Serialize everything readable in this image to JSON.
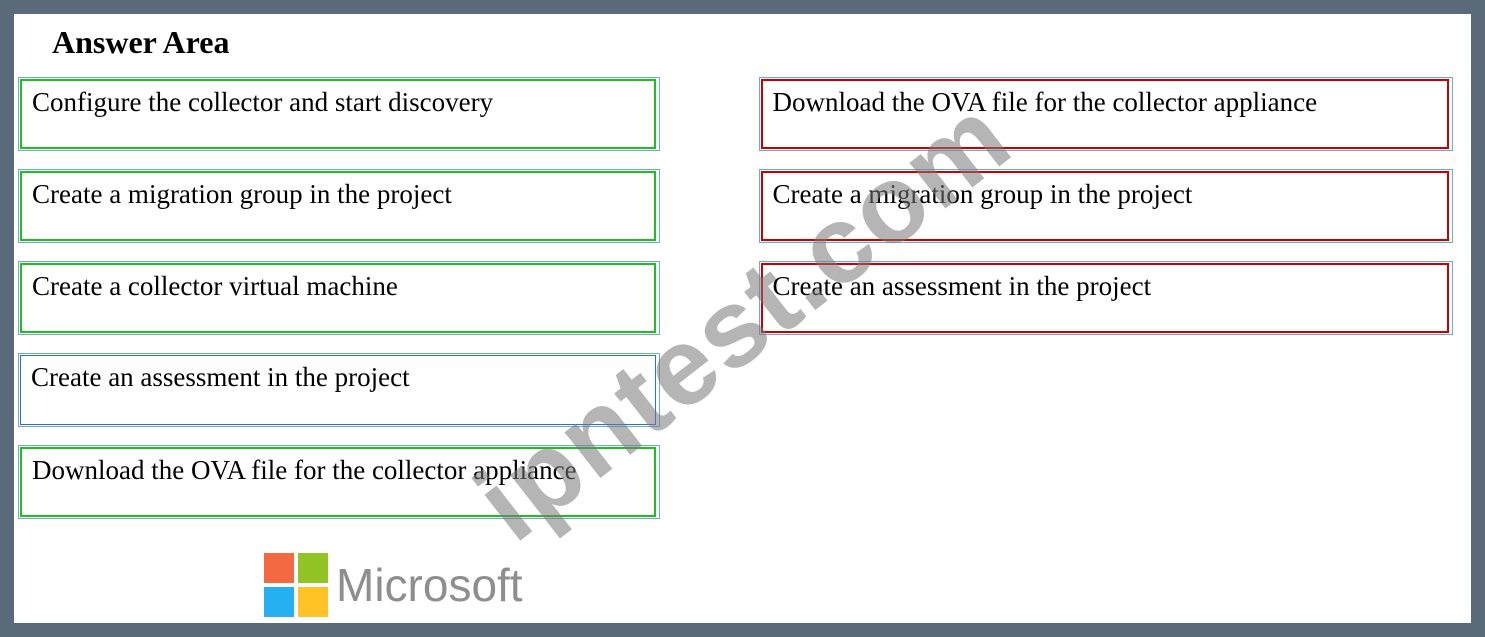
{
  "title": "Answer Area",
  "watermark_text": "ipntest.com",
  "logo_text": "Microsoft",
  "left_column": [
    {
      "text": "Configure the collector and start discovery",
      "style": "green"
    },
    {
      "text": "Create a migration group in the project",
      "style": "green"
    },
    {
      "text": "Create a collector virtual machine",
      "style": "green"
    },
    {
      "text": "Create an assessment in the project",
      "style": "blue"
    },
    {
      "text": "Download the OVA file for the collector appliance",
      "style": "green"
    }
  ],
  "right_column": [
    {
      "text": "Download the OVA file for the collector appliance",
      "style": "red"
    },
    {
      "text": "Create a migration group in the project",
      "style": "red"
    },
    {
      "text": "Create an assessment in the project",
      "style": "red"
    }
  ]
}
